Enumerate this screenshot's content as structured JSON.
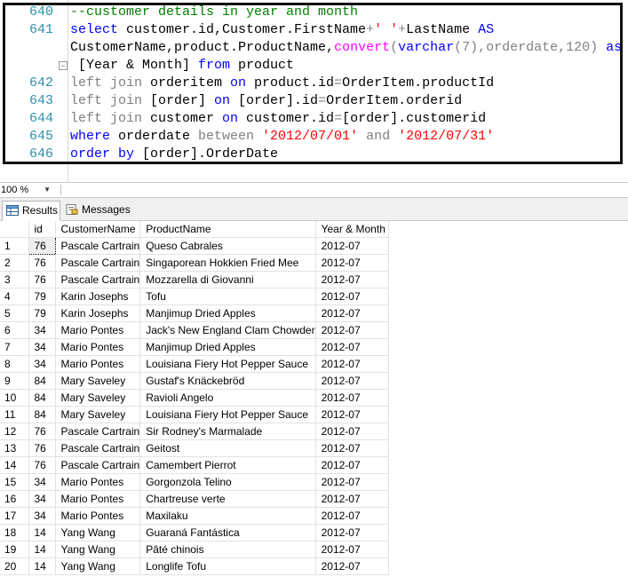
{
  "editor": {
    "line_numbers": [
      "640",
      "641",
      "",
      "",
      "642",
      "643",
      "644",
      "645",
      "646"
    ],
    "lines": [
      [
        [
          "--customer details in year and month",
          "cm"
        ]
      ],
      [
        [
          "select ",
          "kw"
        ],
        [
          "customer.id,Customer.FirstName",
          "tx"
        ],
        [
          "+",
          "gr"
        ],
        [
          "' '",
          "st"
        ],
        [
          "+",
          "gr"
        ],
        [
          "LastName ",
          "tx"
        ],
        [
          "AS",
          "kw"
        ]
      ],
      [
        [
          "CustomerName,product.ProductName,",
          "tx"
        ],
        [
          "convert",
          "fn"
        ],
        [
          "(",
          "gr"
        ],
        [
          "varchar",
          "kw"
        ],
        [
          "(7),orderdate,120) ",
          "gr"
        ],
        [
          "as",
          "kw"
        ]
      ],
      [
        [
          " [Year & Month] ",
          "tx"
        ],
        [
          "from ",
          "kw"
        ],
        [
          "product",
          "tx"
        ]
      ],
      [
        [
          "left join ",
          "gr"
        ],
        [
          "orderitem ",
          "tx"
        ],
        [
          "on ",
          "kw"
        ],
        [
          "product.id",
          "tx"
        ],
        [
          "=",
          "gr"
        ],
        [
          "OrderItem.productId",
          "tx"
        ]
      ],
      [
        [
          "left join ",
          "gr"
        ],
        [
          "[order] ",
          "tx"
        ],
        [
          "on ",
          "kw"
        ],
        [
          "[order].id",
          "tx"
        ],
        [
          "=",
          "gr"
        ],
        [
          "OrderItem.orderid",
          "tx"
        ]
      ],
      [
        [
          "left join ",
          "gr"
        ],
        [
          "customer ",
          "tx"
        ],
        [
          "on ",
          "kw"
        ],
        [
          "customer.id",
          "tx"
        ],
        [
          "=",
          "gr"
        ],
        [
          "[order].customerid",
          "tx"
        ]
      ],
      [
        [
          "where ",
          "kw"
        ],
        [
          "orderdate ",
          "tx"
        ],
        [
          "between ",
          "gr"
        ],
        [
          "'2012/07/01' ",
          "st"
        ],
        [
          "and ",
          "gr"
        ],
        [
          "'2012/07/31'",
          "st"
        ]
      ],
      [
        [
          "order by ",
          "kw"
        ],
        [
          "[order].OrderDate",
          "tx"
        ]
      ]
    ]
  },
  "zoom": "100 %",
  "tabs": [
    {
      "label": "Results",
      "icon": "results-grid-icon"
    },
    {
      "label": "Messages",
      "icon": "messages-icon"
    }
  ],
  "grid": {
    "columns": [
      "",
      "id",
      "CustomerName",
      "ProductName",
      "Year & Month"
    ],
    "rows": [
      [
        "1",
        "76",
        "Pascale Cartrain",
        "Queso Cabrales",
        "2012-07"
      ],
      [
        "2",
        "76",
        "Pascale Cartrain",
        "Singaporean Hokkien Fried Mee",
        "2012-07"
      ],
      [
        "3",
        "76",
        "Pascale Cartrain",
        "Mozzarella di Giovanni",
        "2012-07"
      ],
      [
        "4",
        "79",
        "Karin Josephs",
        "Tofu",
        "2012-07"
      ],
      [
        "5",
        "79",
        "Karin Josephs",
        "Manjimup Dried Apples",
        "2012-07"
      ],
      [
        "6",
        "34",
        "Mario Pontes",
        "Jack's New England Clam Chowder",
        "2012-07"
      ],
      [
        "7",
        "34",
        "Mario Pontes",
        "Manjimup Dried Apples",
        "2012-07"
      ],
      [
        "8",
        "34",
        "Mario Pontes",
        "Louisiana Fiery Hot Pepper Sauce",
        "2012-07"
      ],
      [
        "9",
        "84",
        "Mary Saveley",
        "Gustaf's Knäckebröd",
        "2012-07"
      ],
      [
        "10",
        "84",
        "Mary Saveley",
        "Ravioli Angelo",
        "2012-07"
      ],
      [
        "11",
        "84",
        "Mary Saveley",
        "Louisiana Fiery Hot Pepper Sauce",
        "2012-07"
      ],
      [
        "12",
        "76",
        "Pascale Cartrain",
        "Sir Rodney's Marmalade",
        "2012-07"
      ],
      [
        "13",
        "76",
        "Pascale Cartrain",
        "Geitost",
        "2012-07"
      ],
      [
        "14",
        "76",
        "Pascale Cartrain",
        "Camembert Pierrot",
        "2012-07"
      ],
      [
        "15",
        "34",
        "Mario Pontes",
        "Gorgonzola Telino",
        "2012-07"
      ],
      [
        "16",
        "34",
        "Mario Pontes",
        "Chartreuse verte",
        "2012-07"
      ],
      [
        "17",
        "34",
        "Mario Pontes",
        "Maxilaku",
        "2012-07"
      ],
      [
        "18",
        "14",
        "Yang Wang",
        "Guaraná Fantástica",
        "2012-07"
      ],
      [
        "19",
        "14",
        "Yang Wang",
        "Pâté chinois",
        "2012-07"
      ],
      [
        "20",
        "14",
        "Yang Wang",
        "Longlife Tofu",
        "2012-07"
      ]
    ]
  }
}
